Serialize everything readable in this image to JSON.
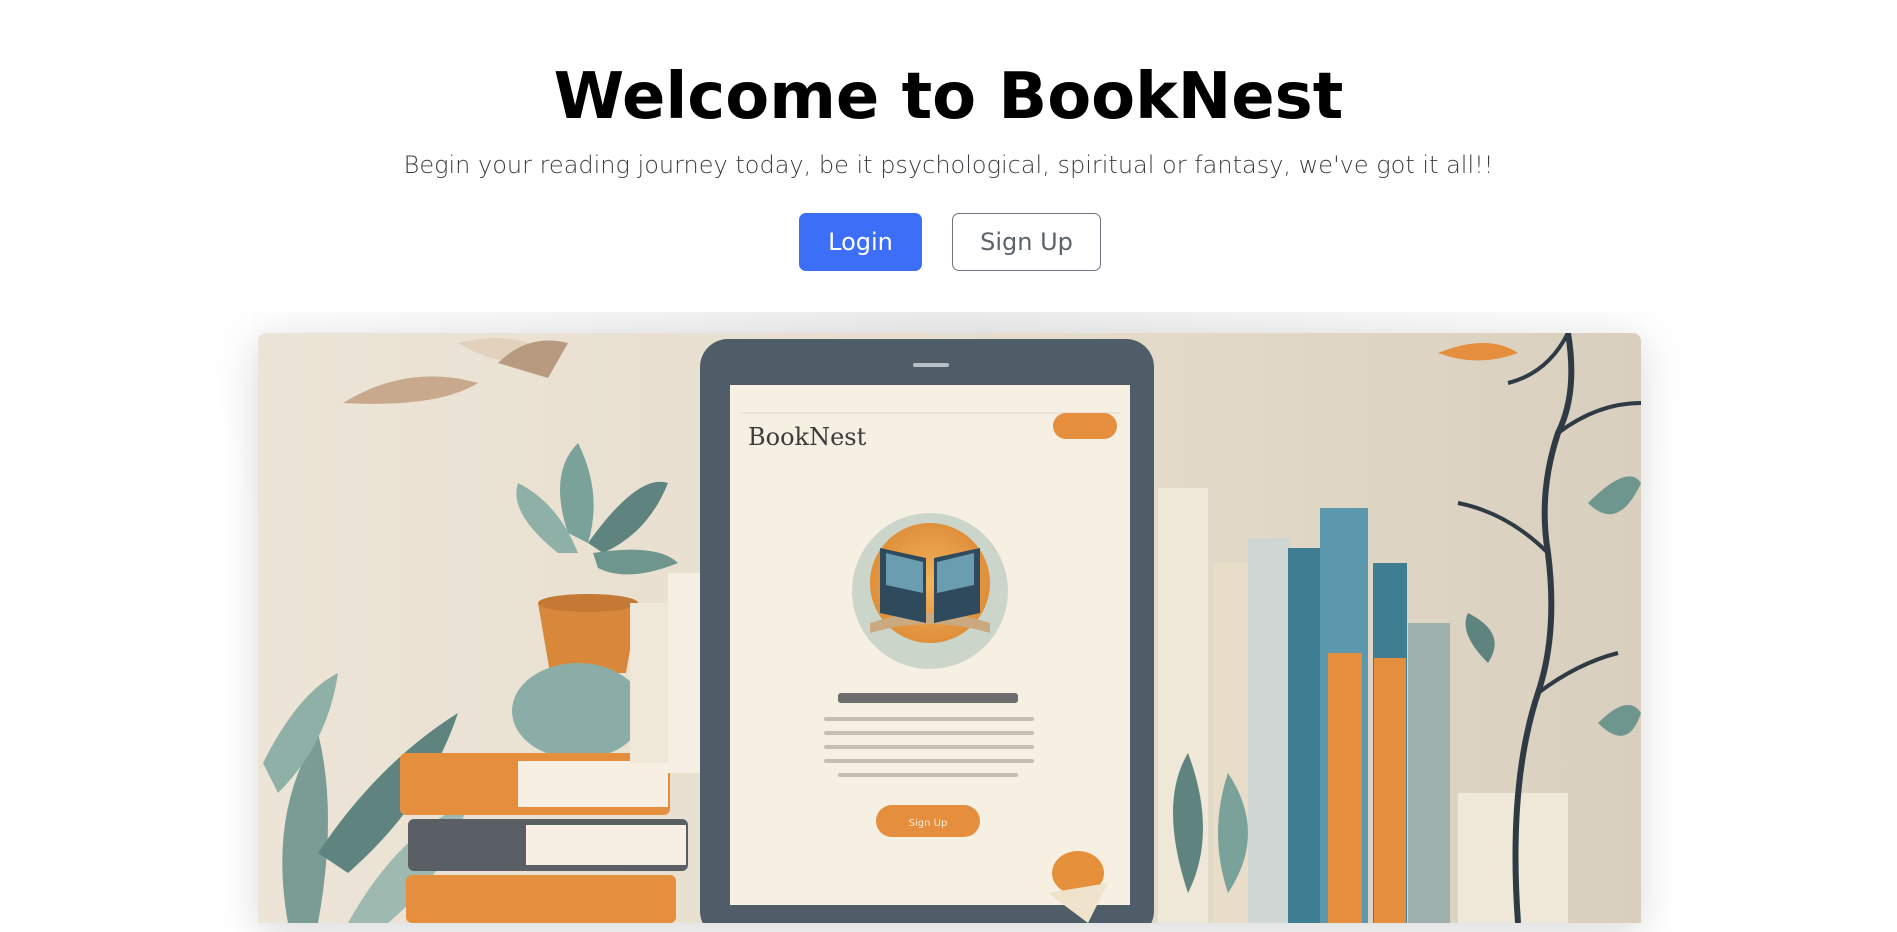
{
  "hero": {
    "title": "Welcome to BookNest",
    "subtitle": "Begin your reading journey today, be it psychological, spiritual or fantasy, we've got it all!!"
  },
  "actions": {
    "login_label": "Login",
    "signup_label": "Sign Up"
  },
  "illustration": {
    "tablet_brand": "BookNest",
    "tablet_button": "Sign Up"
  },
  "colors": {
    "primary": "#3c6ef8",
    "secondary_border": "#6c757d",
    "background": "#ffffff"
  }
}
